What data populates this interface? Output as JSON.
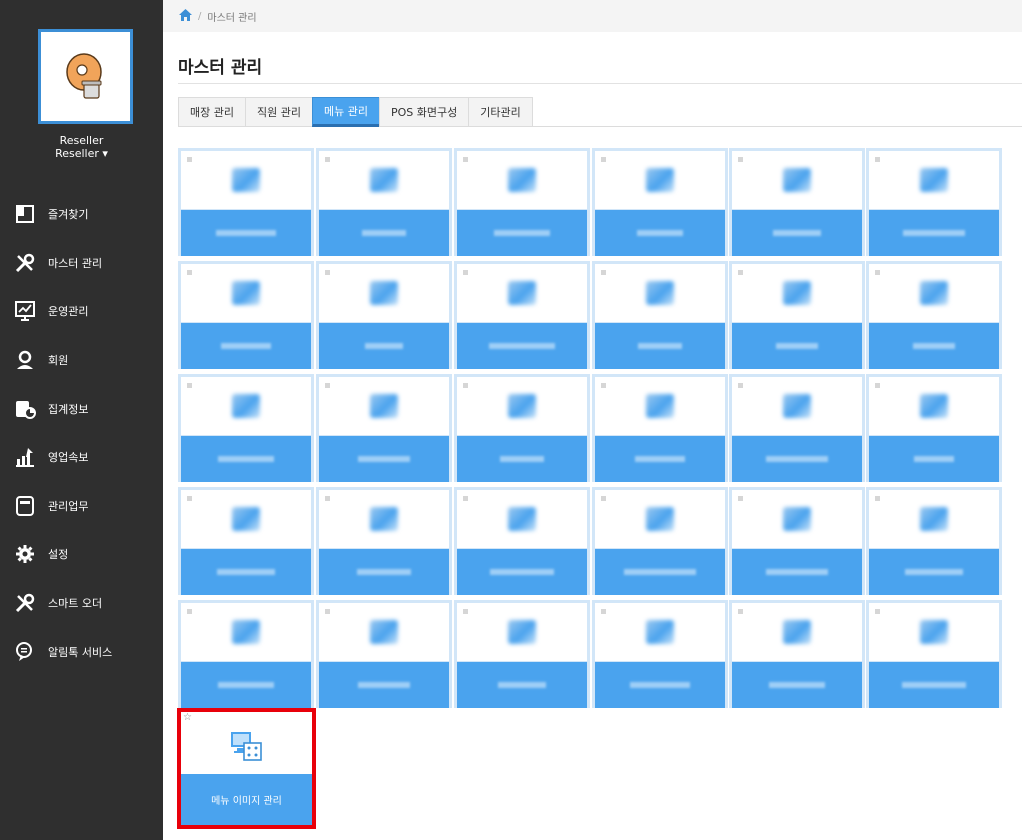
{
  "sidebar": {
    "user_name": "Reseller",
    "user_role": "Reseller ▾",
    "items": [
      {
        "label": "즐겨찾기",
        "icon": "bookmark-icon"
      },
      {
        "label": "마스터 관리",
        "icon": "tools-icon"
      },
      {
        "label": "운영관리",
        "icon": "chart-board-icon"
      },
      {
        "label": "회원",
        "icon": "member-icon"
      },
      {
        "label": "집계정보",
        "icon": "stats-icon"
      },
      {
        "label": "영업속보",
        "icon": "bar-up-icon"
      },
      {
        "label": "관리업무",
        "icon": "document-icon"
      },
      {
        "label": "설정",
        "icon": "gear-icon"
      },
      {
        "label": "스마트 오더",
        "icon": "tools-icon"
      },
      {
        "label": "알림톡 서비스",
        "icon": "chat-icon"
      }
    ]
  },
  "breadcrumb": {
    "current": "마스터 관리"
  },
  "page_title": "마스터 관리",
  "tabs": [
    {
      "label": "매장 관리",
      "active": false
    },
    {
      "label": "직원 관리",
      "active": false
    },
    {
      "label": "메뉴 관리",
      "active": true
    },
    {
      "label": "POS 화면구성",
      "active": false
    },
    {
      "label": "기타관리",
      "active": false
    }
  ],
  "selected_tile": {
    "label": "메뉴 이미지 관리",
    "star": "☆"
  },
  "colors": {
    "accent": "#4aa3ee",
    "sidebar": "#2f2f2f",
    "highlight": "#e8000a"
  }
}
